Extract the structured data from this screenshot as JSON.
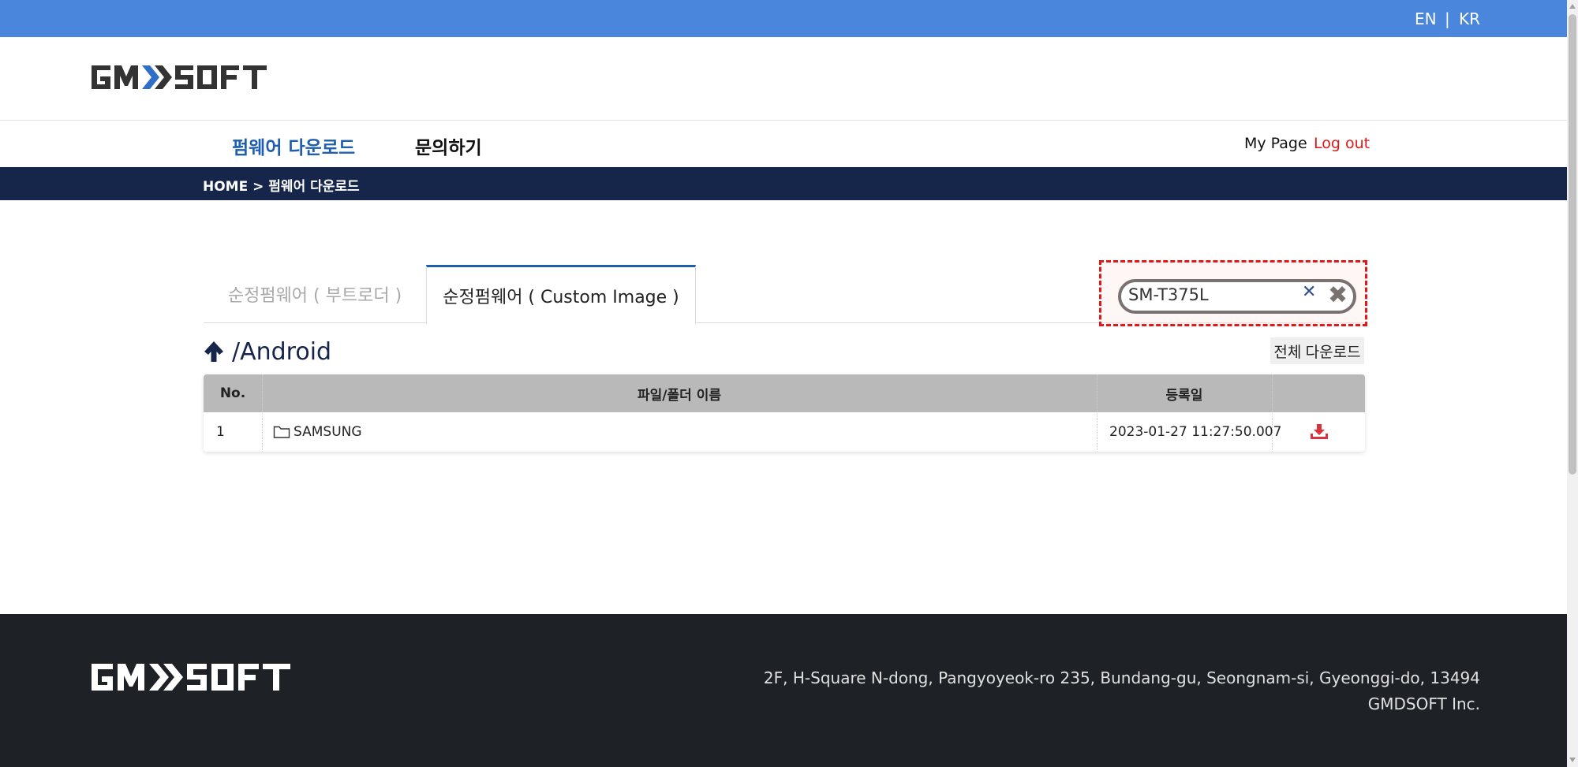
{
  "topbar": {
    "lang_en": "EN",
    "lang_sep": "|",
    "lang_kr": "KR",
    "color": "#4a86dc"
  },
  "logo": {
    "text": "GMDSOFT"
  },
  "nav": {
    "firmware": "펌웨어 다운로드",
    "inquiry": "문의하기",
    "mypage": "My Page",
    "logout": "Log out"
  },
  "breadcrumb": "HOME > 펌웨어 다운로드",
  "tabs": [
    {
      "label": "순정펌웨어 ( 부트로더 )",
      "active": false
    },
    {
      "label": "순정펌웨어 ( Custom Image )",
      "active": true
    }
  ],
  "search": {
    "value": "SM-T375L",
    "placeholder": ""
  },
  "path": "/Android",
  "download_all_label": "전체 다운로드",
  "table": {
    "headers": [
      "No.",
      "파일/폴더 이름",
      "등록일",
      ""
    ],
    "rows": [
      {
        "no": "1",
        "name": "SAMSUNG",
        "date": "2023-01-27 11:27:50.007",
        "type": "folder"
      }
    ]
  },
  "footer": {
    "logo_text": "GMDSOFT",
    "address": "2F, H-Square N-dong, Pangyoyeok-ro 235, Bundang-gu, Seongnam-si, Gyeonggi-do, 13494",
    "company": "GMDSOFT Inc."
  }
}
